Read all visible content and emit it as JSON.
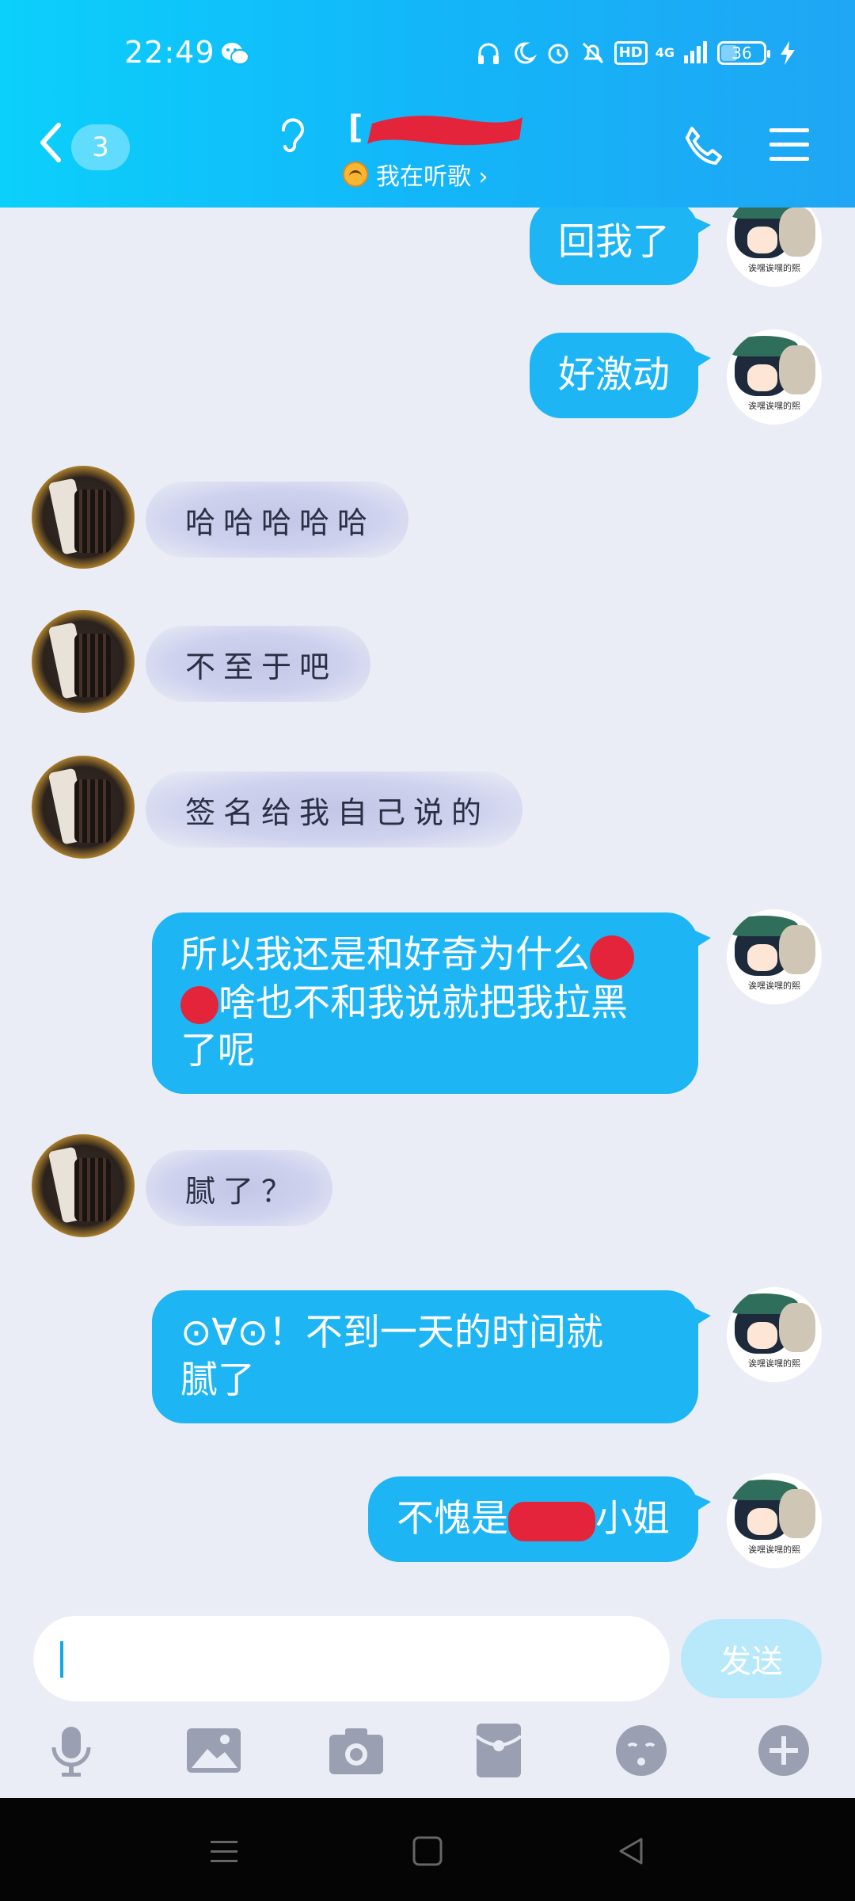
{
  "status_bar": {
    "time": "22:49",
    "network": "4G",
    "hd": "HD",
    "battery": "36",
    "icons": [
      "wechat-icon",
      "headphones-icon",
      "moon-icon",
      "alarm-icon",
      "mute-bell-icon",
      "signal-icon",
      "charging-icon"
    ]
  },
  "header": {
    "unread_count": "3",
    "contact_name_visible": "[",
    "contact_status": "我在听歌 ›"
  },
  "messages": [
    {
      "side": "right",
      "parts": [
        "回我了"
      ]
    },
    {
      "side": "right",
      "parts": [
        "好激动"
      ]
    },
    {
      "side": "left",
      "text": "哈哈哈哈哈"
    },
    {
      "side": "left",
      "text": "不至于吧"
    },
    {
      "side": "left",
      "text": "签名给我自己说的"
    },
    {
      "side": "right",
      "line1a": "所以我还是和好奇为什么",
      "line2b": "啥也不和我说就把我拉黑",
      "line3": "了呢"
    },
    {
      "side": "left",
      "text": "腻了？"
    },
    {
      "side": "right",
      "line1": "⊙∀⊙！不到一天的时间就",
      "line2": "腻了"
    },
    {
      "side": "right",
      "before": "不愧是",
      "after": "小姐"
    }
  ],
  "avatar_caption": "诶嘿诶嘿的熙",
  "input": {
    "value": "",
    "send_label": "发送"
  },
  "colors": {
    "header": "#13b6f9",
    "bubble_self": "#1eb5f5",
    "background": "#eaedf5",
    "send_disabled": "#b8e9fb",
    "redaction": "#e3243a"
  }
}
